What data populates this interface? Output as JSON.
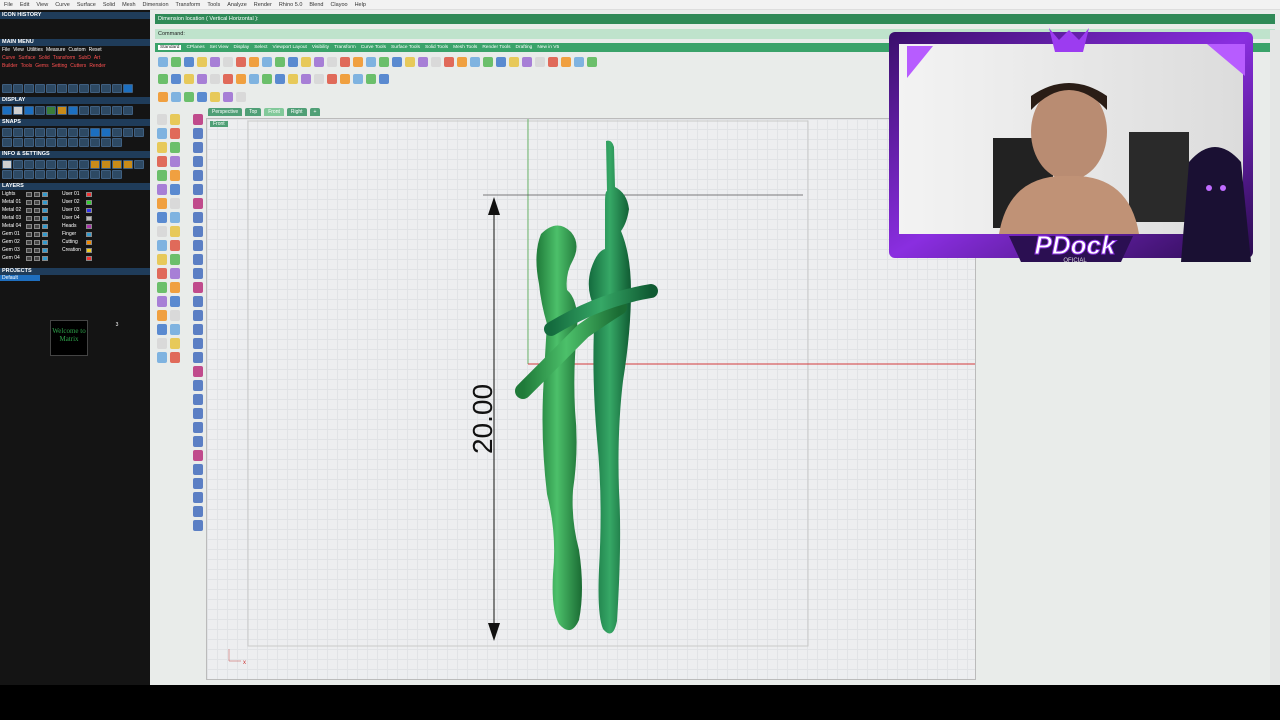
{
  "menubar": [
    "File",
    "Edit",
    "View",
    "Curve",
    "Surface",
    "Solid",
    "Mesh",
    "Dimension",
    "Transform",
    "Tools",
    "Analyze",
    "Render",
    "Rhino 5.0",
    "Blend",
    "Clayoo",
    "Help"
  ],
  "left_panel": {
    "icon_history": "ICON HISTORY",
    "main_menu": "MAIN MENU",
    "menu_row1": [
      "File",
      "View",
      "Utilities",
      "Measure",
      "Custom",
      "Reset"
    ],
    "menu_row2": [
      "Curve",
      "Surface",
      "Solid",
      "Transform",
      "SubD",
      "Art"
    ],
    "menu_row3": [
      "Builder",
      "Tools",
      "Gems",
      "Setting",
      "Cutters",
      "Render"
    ],
    "display": "DISPLAY",
    "snaps": "SNAPS",
    "info_settings": "INFO & SETTINGS",
    "layers": "LAYERS",
    "layers_left": [
      "Lights",
      "Metal 01",
      "Metal 02",
      "Metal 03",
      "Metal 04",
      "Gem 01",
      "Gem 02",
      "Gem 03",
      "Gem 04"
    ],
    "layers_right": [
      "User 01",
      "User 02",
      "User 03",
      "User 04",
      "Heads",
      "Finger",
      "Cutting",
      "Creation"
    ],
    "projects": "PROJECTS",
    "project_default": "Default",
    "project_tabs": [
      "1",
      "2",
      "3"
    ],
    "project_thumb": "Welcome to Matrix"
  },
  "command": {
    "prompt": "Dimension location ( Vertical  Horizontal ):",
    "command_label": "Command:"
  },
  "toolbar_tabs": [
    "Standard",
    "CPlanes",
    "Set View",
    "Display",
    "Select",
    "Viewport Layout",
    "Visibility",
    "Transform",
    "Curve Tools",
    "Surface Tools",
    "Solid Tools",
    "Mesh Tools",
    "Render Tools",
    "Drafting",
    "New in V5"
  ],
  "viewport_tabs": [
    "Perspective",
    "Top",
    "Front",
    "Right"
  ],
  "viewport_tabs_active": "Front",
  "viewport_label": "Front",
  "dimension": {
    "value": "20.00"
  },
  "axis_label": "x",
  "webcam": {
    "logo_text": "PDock",
    "logo_sub": "OFICIAL"
  },
  "colors": {
    "green_accent": "#2f8a57",
    "figure_green": "#2e9a4a",
    "overlay_purple": "#7a2fd0",
    "axis_red": "#d23b3b"
  }
}
